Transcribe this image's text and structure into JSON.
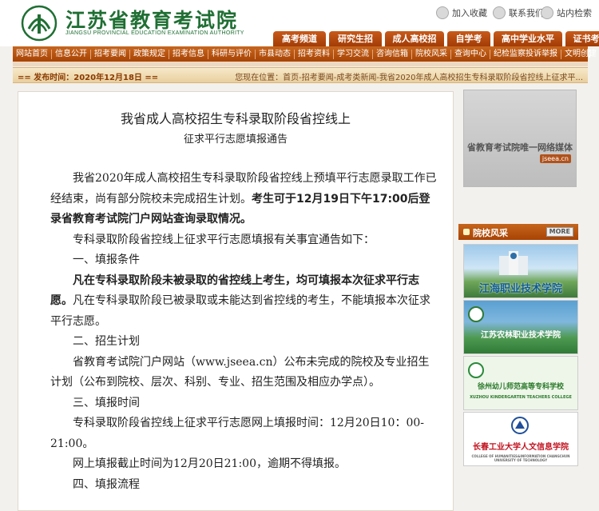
{
  "header": {
    "logo_title": "江苏省教育考试院",
    "logo_subtitle": "JIANGSU PROVINCIAL EDUCATION EXAMINATION AUTHORITY",
    "util": [
      {
        "label": "加入收藏",
        "icon": "star-icon"
      },
      {
        "label": "联系我们",
        "icon": "mail-icon"
      },
      {
        "label": "站内检索",
        "icon": "search-icon"
      }
    ],
    "tabs": [
      "高考频道",
      "研究生招生",
      "成人高校招生",
      "自学考试",
      "高中学业水平考试",
      "证书考试"
    ]
  },
  "nav": [
    "网站首页",
    "信息公开",
    "招考要闻",
    "政策规定",
    "招考信息",
    "科研与评价",
    "市县动态",
    "招考资料",
    "学习交流",
    "咨询信箱",
    "院校风采",
    "查询中心",
    "纪检监察投诉举报",
    "文明创建"
  ],
  "info_bar": {
    "published": "== 发布时间：2020年12月18日 ==",
    "breadcrumb": "您现在位置：首页-招考要闻-成考类新闻-我省2020年成人高校招生专科录取阶段省控线上征求平..."
  },
  "article": {
    "title": "我省成人高校招生专科录取阶段省控线上",
    "subtitle": "征求平行志愿填报通告",
    "p1_a": "我省2020年成人高校招生专科录取阶段省控线上预填平行志愿录取工作已经结束，尚有部分院校未完成招生计划。",
    "p1_b": "考生可于12月19日下午17:00后登录省教育考试院门户网站查询录取情况。",
    "p2": "专科录取阶段省控线上征求平行志愿填报有关事宜通告如下：",
    "h1": "一、填报条件",
    "p3_a": "凡在专科录取阶段未被录取的省控线上考生，均可填报本次征求平行志愿。",
    "p3_b": "凡在专科录取阶段已被录取或未能达到省控线的考生，不能填报本次征求平行志愿。",
    "h2": "二、招生计划",
    "p4": "省教育考试院门户网站（www.jseea.cn）公布未完成的院校及专业招生计划（公布到院校、层次、科别、专业、招生范围及相应办学点）。",
    "h3": "三、填报时间",
    "p5": "专科录取阶段省控线上征求平行志愿网上填报时间：12月20日10：00-21:00。",
    "p6": "网上填报截止时间为12月20日21:00，逾期不得填报。",
    "h4": "四、填报流程"
  },
  "sidebar": {
    "banner_text": "省教育考试院唯一网络媒体",
    "banner_url": "jseea.cn",
    "section_title": "院校风采",
    "more": "MORE",
    "colleges": [
      {
        "name": "江海职业技术学院",
        "sub": ""
      },
      {
        "name": "江苏农林职业技术学院",
        "sub": ""
      },
      {
        "name": "徐州幼儿师范高等专科学校",
        "sub": "XUZHOU KINDERGARTEN TEACHERS COLLEGE"
      },
      {
        "name": "长春工业大学人文信息学院",
        "sub": "COLLEGE OF HUMANITIES&INFORMATION CHANGCHUN UNIVERSITY OF TECHNOLOGY"
      }
    ]
  },
  "colors": {
    "accent": "#b5500f",
    "logo_green": "#1f6f33"
  }
}
